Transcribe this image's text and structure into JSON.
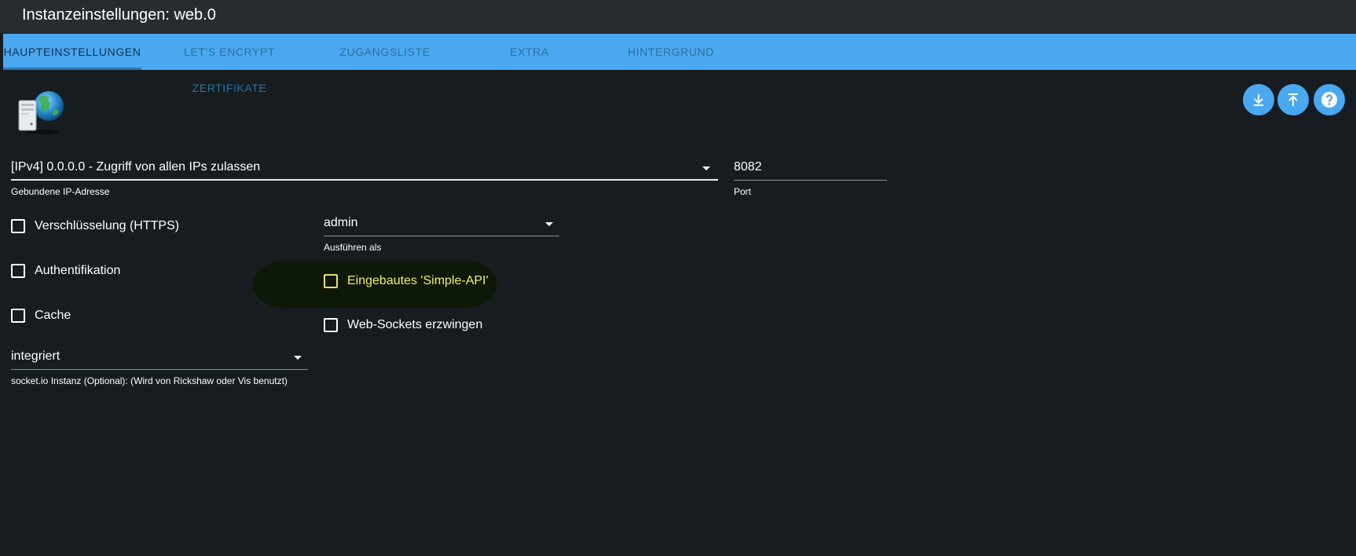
{
  "window": {
    "title": "Instanzeinstellungen: web.0"
  },
  "tabs": [
    {
      "label": "HAUPTEINSTELLUNGEN",
      "active": true
    },
    {
      "label": "LET'S ENCRYPT ZERTIFIKATE",
      "active": false
    },
    {
      "label": "ZUGANGSLISTE",
      "active": false
    },
    {
      "label": "EXTRA",
      "active": false
    },
    {
      "label": "HINTERGRUND",
      "active": false
    }
  ],
  "toolbar": {
    "icons": [
      "download-icon",
      "upload-icon",
      "help-icon"
    ]
  },
  "form": {
    "bind_ip": {
      "value": "[IPv4] 0.0.0.0 - Zugriff von allen IPs zulassen",
      "hint": "Gebundene IP-Adresse"
    },
    "port": {
      "value": "8082",
      "hint": "Port"
    },
    "https": {
      "label": "Verschlüsselung (HTTPS)",
      "checked": false
    },
    "auth": {
      "label": "Authentifikation",
      "checked": false
    },
    "cache": {
      "label": "Cache",
      "checked": false
    },
    "run_as": {
      "value": "admin",
      "hint": "Ausführen als"
    },
    "simple_api": {
      "label": "Eingebautes 'Simple-API'",
      "checked": false,
      "highlighted": true
    },
    "force_websockets": {
      "label": "Web-Sockets erzwingen",
      "checked": false
    },
    "socketio": {
      "value": "integriert",
      "hint": "socket.io Instanz (Optional): (Wird von Rickshaw oder Vis benutzt)"
    }
  },
  "colors": {
    "accent": "#4aa8f0",
    "background": "#161c20",
    "titlebar": "#272c31",
    "highlight_text": "#f2ee6a"
  }
}
